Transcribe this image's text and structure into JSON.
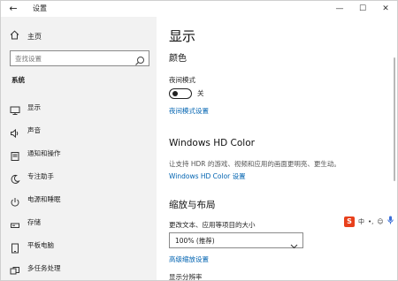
{
  "window": {
    "title": "设置",
    "back_glyph": "←",
    "min_glyph": "—",
    "max_glyph": "☐",
    "close_glyph": "✕"
  },
  "sidebar": {
    "home_label": "主页",
    "search_placeholder": "查找设置",
    "section_title": "系统",
    "items": [
      {
        "label": "显示",
        "icon": "monitor-icon"
      },
      {
        "label": "声音",
        "icon": "speaker-icon"
      },
      {
        "label": "通知和操作",
        "icon": "notification-icon"
      },
      {
        "label": "专注助手",
        "icon": "moon-icon"
      },
      {
        "label": "电源和睡眠",
        "icon": "power-icon"
      },
      {
        "label": "存储",
        "icon": "storage-icon"
      },
      {
        "label": "平板电脑",
        "icon": "tablet-icon"
      },
      {
        "label": "多任务处理",
        "icon": "multitask-icon"
      }
    ]
  },
  "main": {
    "page_title": "显示",
    "color": {
      "heading": "颜色",
      "night_light_label": "夜间模式",
      "night_light_state": "关",
      "night_light_settings_link": "夜间模式设置"
    },
    "hdr": {
      "heading": "Windows HD Color",
      "description": "让支持 HDR 的游戏、视频和应用的画面更明亮、更生动。",
      "settings_link": "Windows HD Color 设置"
    },
    "scale": {
      "heading": "缩放与布局",
      "size_label": "更改文本、应用等项目的大小",
      "size_value": "100% (推荐)",
      "advanced_link": "高级缩放设置",
      "resolution_label": "显示分辨率"
    }
  },
  "ime": {
    "logo": "S",
    "lang": "中",
    "punct": "•,",
    "emoji": "☺",
    "mic": "🎤"
  },
  "colors": {
    "sidebar_bg": "#f2f2f2",
    "link": "#0063b1",
    "ime_logo": "#e8401c"
  }
}
